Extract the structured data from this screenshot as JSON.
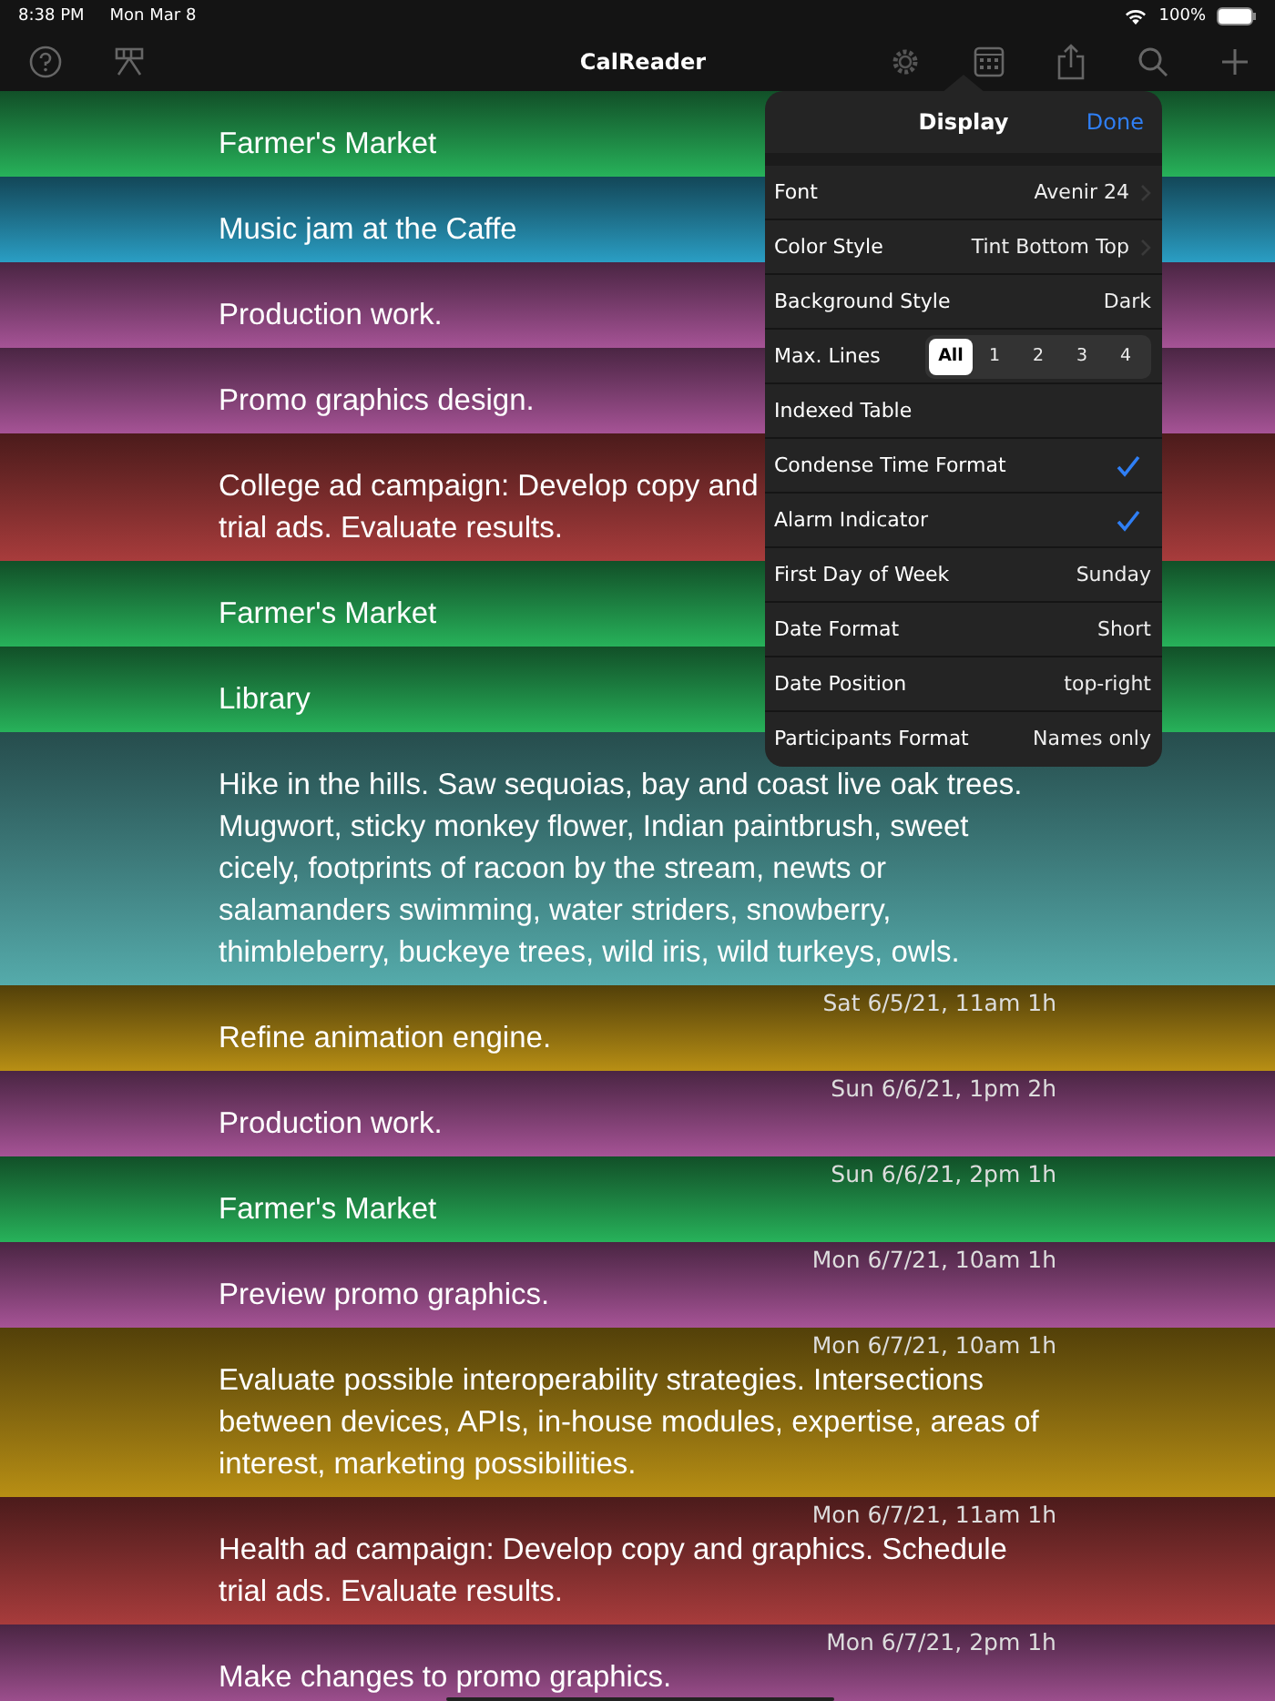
{
  "status_bar": {
    "time": "8:38 PM",
    "date": "Mon Mar 8",
    "battery": "100%"
  },
  "toolbar": {
    "title": "CalReader"
  },
  "events": [
    {
      "lines": [
        "Farmer's Market"
      ],
      "color": "#27b25a"
    },
    {
      "lines": [
        "Music jam at the Caffe"
      ],
      "color": "#2a9ec4"
    },
    {
      "lines": [
        "Production work."
      ],
      "color": "#a65396"
    },
    {
      "lines": [
        "Promo graphics design."
      ],
      "color": "#a65396"
    },
    {
      "lines": [
        "College ad campaign: Develop copy and",
        "trial ads. Evaluate results."
      ],
      "color": "#a83c3c"
    },
    {
      "lines": [
        "Farmer's Market"
      ],
      "color": "#27b25a"
    },
    {
      "lines": [
        "Library"
      ],
      "color": "#27b25a"
    },
    {
      "lines": [
        "Hike in the hills. Saw sequoias, bay and coast live oak trees.",
        "Mugwort, sticky monkey flower, Indian paintbrush, sweet",
        "cicely, footprints of racoon by the stream, newts or",
        "salamanders swimming, water striders, snowberry,",
        "thimbleberry, buckeye trees, wild iris, wild turkeys, owls."
      ],
      "color": "#55abab"
    },
    {
      "date": "Sat 6/5/21, 11am 1h",
      "lines": [
        "Refine animation engine."
      ],
      "color": "#b88f14"
    },
    {
      "date": "Sun 6/6/21, 1pm 2h",
      "lines": [
        "Production work."
      ],
      "color": "#a65396"
    },
    {
      "date": "Sun 6/6/21, 2pm 1h",
      "lines": [
        "Farmer's Market"
      ],
      "color": "#27b25a"
    },
    {
      "date": "Mon 6/7/21, 10am 1h",
      "lines": [
        "Preview promo graphics."
      ],
      "color": "#a65396"
    },
    {
      "date": "Mon 6/7/21, 10am 1h",
      "lines": [
        "Evaluate possible interoperability strategies. Intersections",
        "between devices, APIs, in-house modules, expertise, areas of",
        "interest, marketing possibilities."
      ],
      "color": "#b88f14"
    },
    {
      "date": "Mon 6/7/21, 11am 1h",
      "lines": [
        "Health ad campaign: Develop copy and graphics. Schedule",
        "trial ads. Evaluate results."
      ],
      "color": "#a83c3c"
    },
    {
      "date": "Mon 6/7/21, 2pm 1h",
      "lines": [
        "Make changes to promo graphics."
      ],
      "color": "#a65396"
    }
  ],
  "popover": {
    "title": "Display",
    "done": "Done",
    "rows": [
      {
        "kind": "disclosure",
        "label": "Font",
        "value": "Avenir 24"
      },
      {
        "kind": "disclosure",
        "label": "Color Style",
        "value": "Tint Bottom Top"
      },
      {
        "kind": "value",
        "label": "Background Style",
        "value": "Dark"
      },
      {
        "kind": "segmented",
        "label": "Max. Lines",
        "options": [
          {
            "label": "All",
            "selected": true
          },
          {
            "label": "1",
            "selected": false
          },
          {
            "label": "2",
            "selected": false
          },
          {
            "label": "3",
            "selected": false
          },
          {
            "label": "4",
            "selected": false
          }
        ]
      },
      {
        "kind": "check",
        "label": "Indexed Table",
        "checked": false
      },
      {
        "kind": "check",
        "label": "Condense Time Format",
        "checked": true
      },
      {
        "kind": "check",
        "label": "Alarm Indicator",
        "checked": true
      },
      {
        "kind": "value",
        "label": "First Day of Week",
        "value": "Sunday"
      },
      {
        "kind": "value",
        "label": "Date Format",
        "value": "Short"
      },
      {
        "kind": "value",
        "label": "Date Position",
        "value": "top-right"
      },
      {
        "kind": "value",
        "label": "Participants Format",
        "value": "Names only"
      }
    ]
  }
}
